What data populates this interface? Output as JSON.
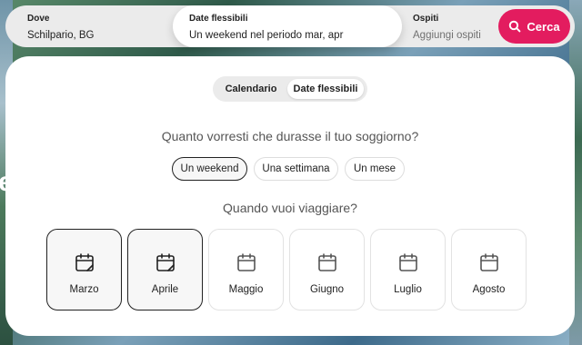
{
  "search": {
    "where": {
      "label": "Dove",
      "value": "Schilpario, BG"
    },
    "dates": {
      "label": "Date flessibili",
      "value": "Un weekend nel periodo mar, apr"
    },
    "guests": {
      "label": "Ospiti",
      "placeholder": "Aggiungi ospiti"
    },
    "button_label": "Cerca",
    "button_color": "#e31c5f"
  },
  "background_glyph": "e",
  "toggle": {
    "options": [
      "Calendario",
      "Date flessibili"
    ],
    "selected": "Date flessibili"
  },
  "duration": {
    "question": "Quanto vorresti che durasse il tuo soggiorno?",
    "options": [
      "Un weekend",
      "Una settimana",
      "Un mese"
    ],
    "selected": "Un weekend"
  },
  "when": {
    "question": "Quando vuoi viaggiare?",
    "months": [
      {
        "name": "Marzo",
        "selected": true,
        "icon": "calendar-check-icon"
      },
      {
        "name": "Aprile",
        "selected": true,
        "icon": "calendar-check-icon"
      },
      {
        "name": "Maggio",
        "selected": false,
        "icon": "calendar-icon"
      },
      {
        "name": "Giugno",
        "selected": false,
        "icon": "calendar-icon"
      },
      {
        "name": "Luglio",
        "selected": false,
        "icon": "calendar-icon"
      },
      {
        "name": "Agosto",
        "selected": false,
        "icon": "calendar-icon"
      }
    ]
  }
}
